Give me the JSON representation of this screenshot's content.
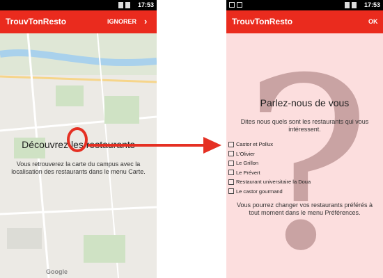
{
  "left_screen": {
    "status_time": "17:53",
    "app_title": "TrouvTonResto",
    "skip_label": "IGNORER",
    "next_label": "›",
    "intro_title": "Découvrez les restaurants",
    "intro_text": "Vous retrouverez la carte du campus avec la localisation des restaurants dans le menu Carte.",
    "map_attribution": "Google"
  },
  "right_screen": {
    "status_time": "17:53",
    "app_title": "TrouvTonResto",
    "ok_label": "OK",
    "title": "Parlez-nous de vous",
    "subtitle": "Dites nous quels sont les restaurants qui vous intéressent.",
    "restaurants": [
      "Castor et Pollux",
      "L'Olivier",
      "Le Grillon",
      "Le Prévert",
      "Restaurant universitaire la Doua",
      "Le castor gourmand"
    ],
    "footer_text": "Vous pourrez changer vos restaurants préférés à tout moment dans le menu Préférences."
  },
  "annotation": {
    "highlight_color": "#e53023",
    "arrow_color": "#e53023"
  }
}
